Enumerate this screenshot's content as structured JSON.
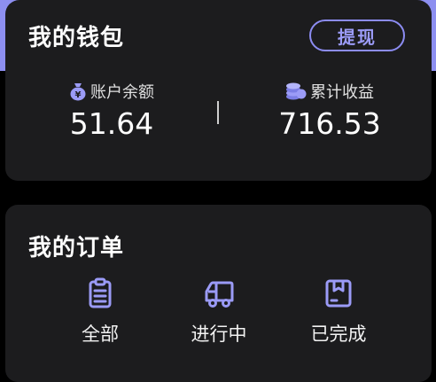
{
  "wallet": {
    "title": "我的钱包",
    "withdraw_label": "提现",
    "balance": {
      "label": "账户余额",
      "value": "51.64",
      "icon": "money-bag-icon"
    },
    "earnings": {
      "label": "累计收益",
      "value": "716.53",
      "icon": "coins-icon"
    }
  },
  "orders": {
    "title": "我的订单",
    "items": [
      {
        "label": "全部",
        "icon": "clipboard-icon"
      },
      {
        "label": "进行中",
        "icon": "delivery-truck-icon"
      },
      {
        "label": "已完成",
        "icon": "package-box-icon"
      }
    ]
  },
  "colors": {
    "accent": "#8c8cf2",
    "card_bg": "#1c1c1e",
    "page_bg": "#000000",
    "header_band": "#8d8ff0"
  }
}
